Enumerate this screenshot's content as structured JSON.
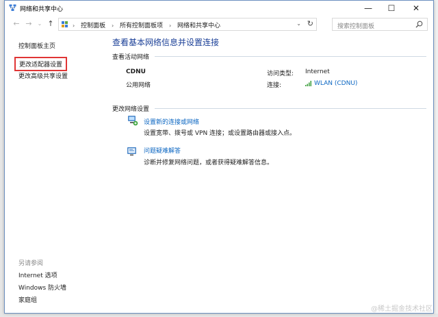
{
  "window": {
    "title": "网络和共享中心",
    "minimize_label": "—",
    "maximize_label": "☐",
    "close_label": "✕"
  },
  "address_bar": {
    "breadcrumbs": [
      "控制面板",
      "所有控制面板项",
      "网络和共享中心"
    ],
    "separator": "›",
    "dropdown_glyph": "⌄",
    "refresh_glyph": "↻"
  },
  "nav": {
    "back": "←",
    "forward": "→",
    "recent": "⌄",
    "up": "↑"
  },
  "search": {
    "placeholder": "搜索控制面板"
  },
  "sidebar": {
    "items": [
      {
        "label": "控制面板主页"
      },
      {
        "label": "更改适配器设置"
      },
      {
        "label": "更改高级共享设置"
      }
    ],
    "see_also": {
      "title": "另请参阅",
      "items": [
        {
          "label": "Internet 选项"
        },
        {
          "label": "Windows 防火墙"
        },
        {
          "label": "家庭组"
        }
      ]
    }
  },
  "main": {
    "heading": "查看基本网络信息并设置连接",
    "active_networks_label": "查看活动网络",
    "network": {
      "name": "CDNU",
      "type": "公用网络",
      "access_type_label": "访问类型:",
      "access_type_value": "Internet",
      "connection_label": "连接:",
      "connection_value": "WLAN (CDNU)"
    },
    "change_settings_label": "更改网络设置",
    "tasks": [
      {
        "icon": "network-setup-icon",
        "link": "设置新的连接或网络",
        "description": "设置宽带、拨号或 VPN 连接；或设置路由器或接入点。"
      },
      {
        "icon": "troubleshoot-icon",
        "link": "问题疑难解答",
        "description": "诊断并修复网络问题，或者获得疑难解答信息。"
      }
    ]
  },
  "watermark": "@稀土掘金技术社区",
  "colors": {
    "accent_link": "#0b66c2",
    "heading": "#1a3f97",
    "highlight_border": "#e03535"
  }
}
